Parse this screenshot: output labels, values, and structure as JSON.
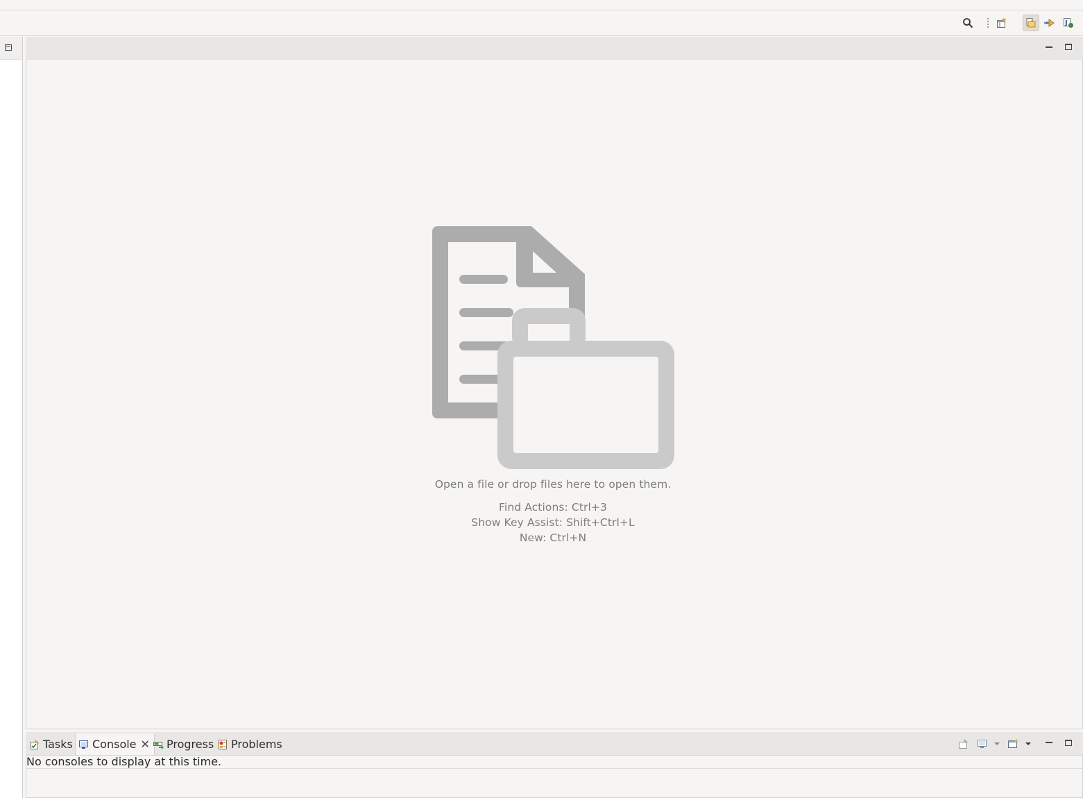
{
  "toolbar": {
    "search_icon": "search-icon",
    "open_perspective_icon": "open-perspective-icon",
    "perspectives": [
      "resource-perspective-icon",
      "debug-perspective-icon",
      "java-perspective-icon"
    ]
  },
  "editor": {
    "empty_message": "Open a file or drop files here to open them.",
    "hints": [
      "Find Actions: Ctrl+3",
      "Show Key Assist: Shift+Ctrl+L",
      "New: Ctrl+N"
    ]
  },
  "bottom_panel": {
    "tabs": [
      {
        "label": "Tasks",
        "icon": "tasks-icon"
      },
      {
        "label": "Console",
        "icon": "console-icon",
        "active": true
      },
      {
        "label": "Progress",
        "icon": "progress-icon"
      },
      {
        "label": "Problems",
        "icon": "problems-icon"
      }
    ],
    "console_message": "No consoles to display at this time.",
    "close_glyph": "✕"
  },
  "colors": {
    "background": "#f6f5f4",
    "tabbar": "#e8e7e5",
    "graphic_dark": "#acacac",
    "graphic_light": "#cacaca",
    "hint_text": "#7d7d7d"
  }
}
